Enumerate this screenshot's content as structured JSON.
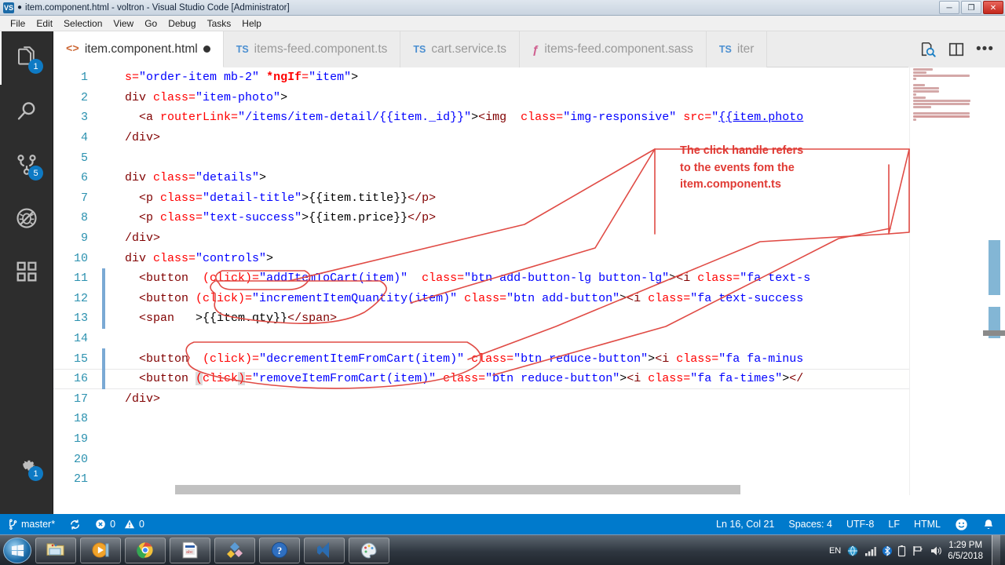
{
  "window": {
    "title": "item.component.html - voltron - Visual Studio Code [Administrator]",
    "dirty_marker": "●",
    "minimize": "─",
    "maximize": "❐",
    "close": "✕",
    "app_icon_label": "VS"
  },
  "menu": {
    "items": [
      "File",
      "Edit",
      "Selection",
      "View",
      "Go",
      "Debug",
      "Tasks",
      "Help"
    ]
  },
  "activitybar": {
    "items": [
      {
        "name": "explorer",
        "badge": "1"
      },
      {
        "name": "search",
        "badge": ""
      },
      {
        "name": "source-control",
        "badge": "5"
      },
      {
        "name": "debug",
        "badge": ""
      },
      {
        "name": "extensions",
        "badge": ""
      }
    ],
    "settings_badge": "1"
  },
  "tabs": [
    {
      "label": "item.component.html",
      "icon": "html-icon",
      "icon_text": "<>",
      "active": true,
      "dirty": true
    },
    {
      "label": "items-feed.component.ts",
      "icon": "ts-icon",
      "icon_text": "TS",
      "active": false,
      "dirty": false
    },
    {
      "label": "cart.service.ts",
      "icon": "ts-icon",
      "icon_text": "TS",
      "active": false,
      "dirty": false
    },
    {
      "label": "items-feed.component.sass",
      "icon": "sass-icon",
      "icon_text": "ƒ",
      "active": false,
      "dirty": false
    },
    {
      "label": "iter",
      "icon": "ts-icon",
      "icon_text": "TS",
      "active": false,
      "dirty": false
    }
  ],
  "tab_actions": {
    "open_changes": "open-changes-icon",
    "split_editor": "split-editor-icon",
    "more": "•••"
  },
  "editor": {
    "lines": [
      {
        "n": "1",
        "indent": false,
        "current": false,
        "tokens": [
          {
            "c": "t-attr",
            "t": "s="
          },
          {
            "c": "t-str",
            "t": "\"order-item mb-2\""
          },
          {
            "c": "t-plain",
            "t": " "
          },
          {
            "c": "t-ng",
            "t": "*ngIf"
          },
          {
            "c": "t-attr",
            "t": "="
          },
          {
            "c": "t-str",
            "t": "\"item\""
          },
          {
            "c": "t-plain",
            "t": ">"
          }
        ]
      },
      {
        "n": "2",
        "indent": false,
        "current": false,
        "tokens": [
          {
            "c": "t-tag",
            "t": "div "
          },
          {
            "c": "t-attr",
            "t": "class="
          },
          {
            "c": "t-str",
            "t": "\"item-photo\""
          },
          {
            "c": "t-plain",
            "t": ">"
          }
        ]
      },
      {
        "n": "3",
        "indent": false,
        "current": false,
        "tokens": [
          {
            "c": "t-plain",
            "t": "  "
          },
          {
            "c": "t-tag",
            "t": "<a "
          },
          {
            "c": "t-attr",
            "t": "routerLink="
          },
          {
            "c": "t-str",
            "t": "\"/items/item-detail/{{item._id}}\""
          },
          {
            "c": "t-plain",
            "t": ">"
          },
          {
            "c": "t-tag",
            "t": "<img"
          },
          {
            "c": "t-plain",
            "t": "  "
          },
          {
            "c": "t-attr",
            "t": "class="
          },
          {
            "c": "t-str",
            "t": "\"img-responsive\""
          },
          {
            "c": "t-plain",
            "t": " "
          },
          {
            "c": "t-attr",
            "t": "src="
          },
          {
            "c": "t-str",
            "t": "\""
          },
          {
            "c": "t-link",
            "t": "{{item.photo"
          }
        ]
      },
      {
        "n": "4",
        "indent": false,
        "current": false,
        "tokens": [
          {
            "c": "t-tag",
            "t": "/div>"
          }
        ]
      },
      {
        "n": "5",
        "indent": false,
        "current": false,
        "tokens": []
      },
      {
        "n": "6",
        "indent": false,
        "current": false,
        "tokens": [
          {
            "c": "t-tag",
            "t": "div "
          },
          {
            "c": "t-attr",
            "t": "class="
          },
          {
            "c": "t-str",
            "t": "\"details\""
          },
          {
            "c": "t-plain",
            "t": ">"
          }
        ]
      },
      {
        "n": "7",
        "indent": false,
        "current": false,
        "tokens": [
          {
            "c": "t-plain",
            "t": "  "
          },
          {
            "c": "t-tag",
            "t": "<p "
          },
          {
            "c": "t-attr",
            "t": "class="
          },
          {
            "c": "t-str",
            "t": "\"detail-title\""
          },
          {
            "c": "t-plain",
            "t": ">{{item.title}}"
          },
          {
            "c": "t-tag",
            "t": "</p>"
          }
        ]
      },
      {
        "n": "8",
        "indent": false,
        "current": false,
        "tokens": [
          {
            "c": "t-plain",
            "t": "  "
          },
          {
            "c": "t-tag",
            "t": "<p "
          },
          {
            "c": "t-attr",
            "t": "class="
          },
          {
            "c": "t-str",
            "t": "\"text-success\""
          },
          {
            "c": "t-plain",
            "t": ">{{item.price}}"
          },
          {
            "c": "t-tag",
            "t": "</p>"
          }
        ]
      },
      {
        "n": "9",
        "indent": false,
        "current": false,
        "tokens": [
          {
            "c": "t-tag",
            "t": "/div>"
          }
        ]
      },
      {
        "n": "10",
        "indent": false,
        "current": false,
        "tokens": [
          {
            "c": "t-tag",
            "t": "div "
          },
          {
            "c": "t-attr",
            "t": "class="
          },
          {
            "c": "t-str",
            "t": "\"controls\""
          },
          {
            "c": "t-plain",
            "t": ">"
          }
        ]
      },
      {
        "n": "11",
        "indent": true,
        "current": false,
        "tokens": [
          {
            "c": "t-plain",
            "t": "  "
          },
          {
            "c": "t-tag",
            "t": "<button "
          },
          {
            "c": "t-plain",
            "t": " "
          },
          {
            "c": "t-attr",
            "t": "(click)="
          },
          {
            "c": "t-str",
            "t": "\"addItemToCart(item)\""
          },
          {
            "c": "t-plain",
            "t": "  "
          },
          {
            "c": "t-attr",
            "t": "class="
          },
          {
            "c": "t-str",
            "t": "\"btn add-button-lg button-lg\""
          },
          {
            "c": "t-plain",
            "t": ">"
          },
          {
            "c": "t-tag",
            "t": "<i "
          },
          {
            "c": "t-attr",
            "t": "class="
          },
          {
            "c": "t-str",
            "t": "\"fa text-s"
          }
        ]
      },
      {
        "n": "12",
        "indent": true,
        "current": false,
        "tokens": [
          {
            "c": "t-plain",
            "t": "  "
          },
          {
            "c": "t-tag",
            "t": "<button "
          },
          {
            "c": "t-attr",
            "t": "(click)="
          },
          {
            "c": "t-str",
            "t": "\"incrementItemQuantity(item)\""
          },
          {
            "c": "t-plain",
            "t": " "
          },
          {
            "c": "t-attr",
            "t": "class="
          },
          {
            "c": "t-str",
            "t": "\"btn add-button\""
          },
          {
            "c": "t-plain",
            "t": ">"
          },
          {
            "c": "t-tag",
            "t": "<i "
          },
          {
            "c": "t-attr",
            "t": "class="
          },
          {
            "c": "t-str",
            "t": "\"fa text-success"
          }
        ]
      },
      {
        "n": "13",
        "indent": true,
        "current": false,
        "tokens": [
          {
            "c": "t-plain",
            "t": "  "
          },
          {
            "c": "t-tag",
            "t": "<span"
          },
          {
            "c": "t-plain",
            "t": "   >{{item.qty}}"
          },
          {
            "c": "t-tag",
            "t": "</span>"
          }
        ]
      },
      {
        "n": "14",
        "indent": false,
        "current": false,
        "tokens": []
      },
      {
        "n": "15",
        "indent": true,
        "current": false,
        "tokens": [
          {
            "c": "t-plain",
            "t": "  "
          },
          {
            "c": "t-tag",
            "t": "<button "
          },
          {
            "c": "t-plain",
            "t": " "
          },
          {
            "c": "t-attr",
            "t": "(click)="
          },
          {
            "c": "t-str",
            "t": "\"decrementItemFromCart(item)\""
          },
          {
            "c": "t-plain",
            "t": " "
          },
          {
            "c": "t-attr",
            "t": "class="
          },
          {
            "c": "t-str",
            "t": "\"btn reduce-button\""
          },
          {
            "c": "t-plain",
            "t": ">"
          },
          {
            "c": "t-tag",
            "t": "<i "
          },
          {
            "c": "t-attr",
            "t": "class="
          },
          {
            "c": "t-str",
            "t": "\"fa fa-minus"
          }
        ]
      },
      {
        "n": "16",
        "indent": true,
        "current": true,
        "tokens": [
          {
            "c": "t-plain",
            "t": "  "
          },
          {
            "c": "t-tag",
            "t": "<button "
          },
          {
            "c": "t-attr t-brk",
            "t": "("
          },
          {
            "c": "t-attr",
            "t": "click"
          },
          {
            "c": "t-attr t-brk",
            "t": ")"
          },
          {
            "c": "t-attr",
            "t": "="
          },
          {
            "c": "t-str",
            "t": "\"removeItemFromCart(item)\""
          },
          {
            "c": "t-plain",
            "t": " "
          },
          {
            "c": "t-attr",
            "t": "class="
          },
          {
            "c": "t-str",
            "t": "\"btn reduce-button\""
          },
          {
            "c": "t-plain",
            "t": ">"
          },
          {
            "c": "t-tag",
            "t": "<i "
          },
          {
            "c": "t-attr",
            "t": "class="
          },
          {
            "c": "t-str",
            "t": "\"fa fa-times\""
          },
          {
            "c": "t-plain",
            "t": ">"
          },
          {
            "c": "t-tag",
            "t": "</"
          }
        ]
      },
      {
        "n": "17",
        "indent": false,
        "current": false,
        "tokens": [
          {
            "c": "t-tag",
            "t": "/div>"
          }
        ]
      },
      {
        "n": "18",
        "indent": false,
        "current": false,
        "tokens": []
      },
      {
        "n": "19",
        "indent": false,
        "current": false,
        "tokens": []
      },
      {
        "n": "20",
        "indent": false,
        "current": false,
        "tokens": []
      },
      {
        "n": "21",
        "indent": false,
        "current": false,
        "tokens": []
      }
    ]
  },
  "annotation": {
    "text_lines": [
      "The click handle refers",
      "to the events fom the",
      "item.component.ts"
    ],
    "color": "#e03a34"
  },
  "statusbar": {
    "branch": "master*",
    "sync_icon": "sync-icon",
    "errors": "0",
    "warnings": "0",
    "cursor_position": "Ln 16, Col 21",
    "indentation": "Spaces: 4",
    "encoding": "UTF-8",
    "eol": "LF",
    "language": "HTML",
    "feedback_icon": "smiley-icon",
    "bell_icon": "bell-icon",
    "background": "#007acc"
  },
  "taskbar": {
    "start_label": "start-orb",
    "tasks": [
      "file-explorer-icon",
      "media-player-icon",
      "google-chrome-icon",
      "document-icon",
      "paint-shapes-icon",
      "help-icon",
      "visual-studio-code-icon",
      "paint-icon"
    ],
    "tray": {
      "language": "EN",
      "icons": [
        "network-icon",
        "signal-icon",
        "bluetooth-icon",
        "battery-icon",
        "flag-icon",
        "volume-icon"
      ],
      "time": "1:29 PM",
      "date": "6/5/2018"
    }
  }
}
